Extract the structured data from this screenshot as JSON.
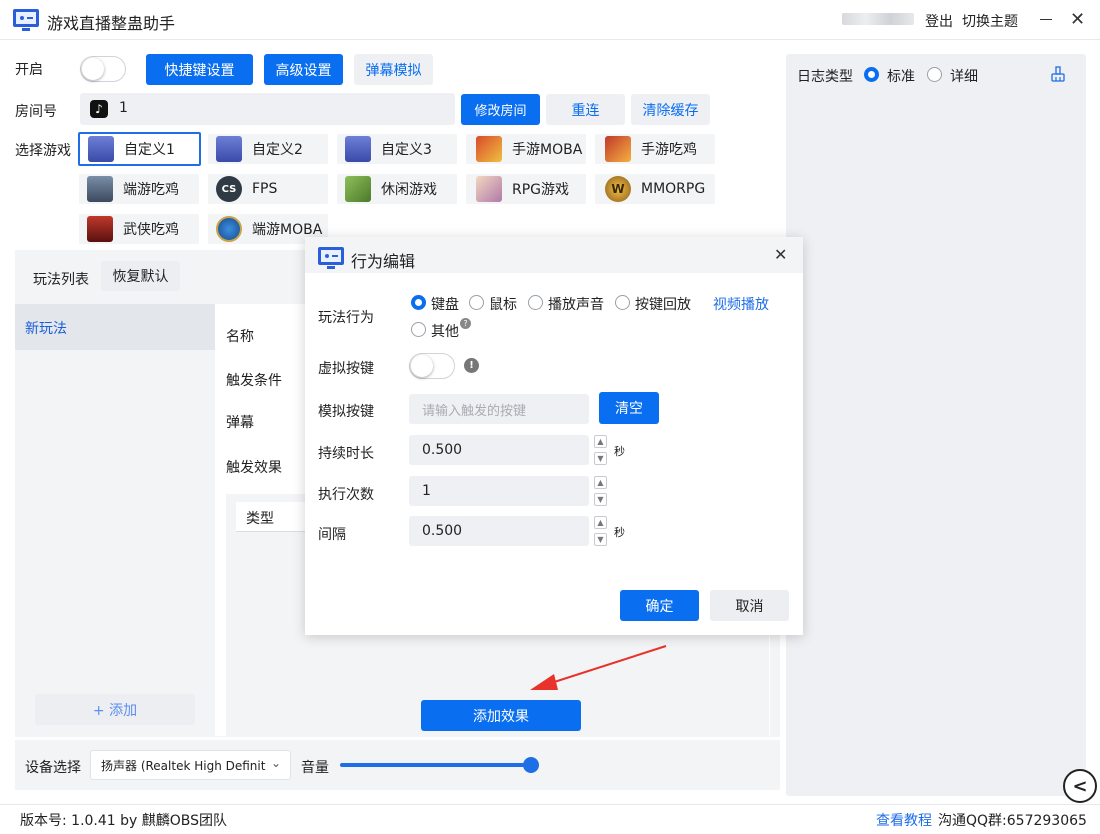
{
  "app": {
    "title": "游戏直播整蛊助手",
    "login": "登出",
    "theme": "切换主题",
    "minimize_icon": "minimize-icon",
    "close_icon": "close-icon"
  },
  "top": {
    "enable_label": "开启",
    "hotkey_btn": "快捷键设置",
    "advanced_btn": "高级设置",
    "danmaku_btn": "弹幕模拟",
    "room_label": "房间号",
    "room_value": "1",
    "modify_room_btn": "修改房间",
    "reconnect_btn": "重连",
    "clear_cache_btn": "清除缓存",
    "select_game_label": "选择游戏"
  },
  "games": [
    {
      "label": "自定义1",
      "icon": "start-game-icon",
      "selected": true
    },
    {
      "label": "自定义2",
      "icon": "start-game-icon"
    },
    {
      "label": "自定义3",
      "icon": "start-game-icon"
    },
    {
      "label": "手游MOBA",
      "icon": "moba-hero-icon"
    },
    {
      "label": "手游吃鸡",
      "icon": "mobile-pubg-icon"
    },
    {
      "label": "端游吃鸡",
      "icon": "pubg-icon"
    },
    {
      "label": "FPS",
      "icon": "cs-icon"
    },
    {
      "label": "休闲游戏",
      "icon": "casual-game-icon"
    },
    {
      "label": "RPG游戏",
      "icon": "rpg-icon"
    },
    {
      "label": "MMORPG",
      "icon": "wow-icon"
    },
    {
      "label": "武侠吃鸡",
      "icon": "wuxia-icon"
    },
    {
      "label": "端游MOBA",
      "icon": "lol-icon"
    }
  ],
  "left": {
    "play_list_tab": "玩法列表",
    "restore_default": "恢复默认",
    "new_play": "新玩法",
    "add": "+ 添加"
  },
  "center": {
    "name_label": "名称",
    "trigger_label": "触发条件",
    "danmaku_label": "弹幕",
    "effect_label": "触发效果",
    "type_col": "类型",
    "add_effect_btn": "添加效果"
  },
  "bottom": {
    "device_label": "设备选择",
    "device_value": "扬声器 (Realtek High Definit",
    "volume_label": "音量",
    "volume": 1.0
  },
  "log": {
    "type_label": "日志类型",
    "standard": "标准",
    "detail": "详细",
    "standard_selected": true
  },
  "dialog": {
    "title": "行为编辑",
    "behavior_label": "玩法行为",
    "behaviors": [
      "键盘",
      "鼠标",
      "播放声音",
      "按键回放"
    ],
    "video_play": "视频播放",
    "other": "其他",
    "virtual_key_label": "虚拟按键",
    "simulate_key_label": "模拟按键",
    "simulate_key_placeholder": "请输入触发的按键",
    "clear_btn": "清空",
    "duration_label": "持续时长",
    "duration_value": "0.500",
    "sec": "秒",
    "count_label": "执行次数",
    "count_value": "1",
    "interval_label": "间隔",
    "interval_value": "0.500",
    "ok_btn": "确定",
    "cancel_btn": "取消"
  },
  "status": {
    "version": "版本号: 1.0.41 by 麒麟OBS团队",
    "tutorial": "查看教程",
    "qq": "沟通QQ群:657293065"
  },
  "colors": {
    "accent": "#0a6ef0",
    "panel": "#f3f4f6",
    "arrow": "#e8322c"
  }
}
